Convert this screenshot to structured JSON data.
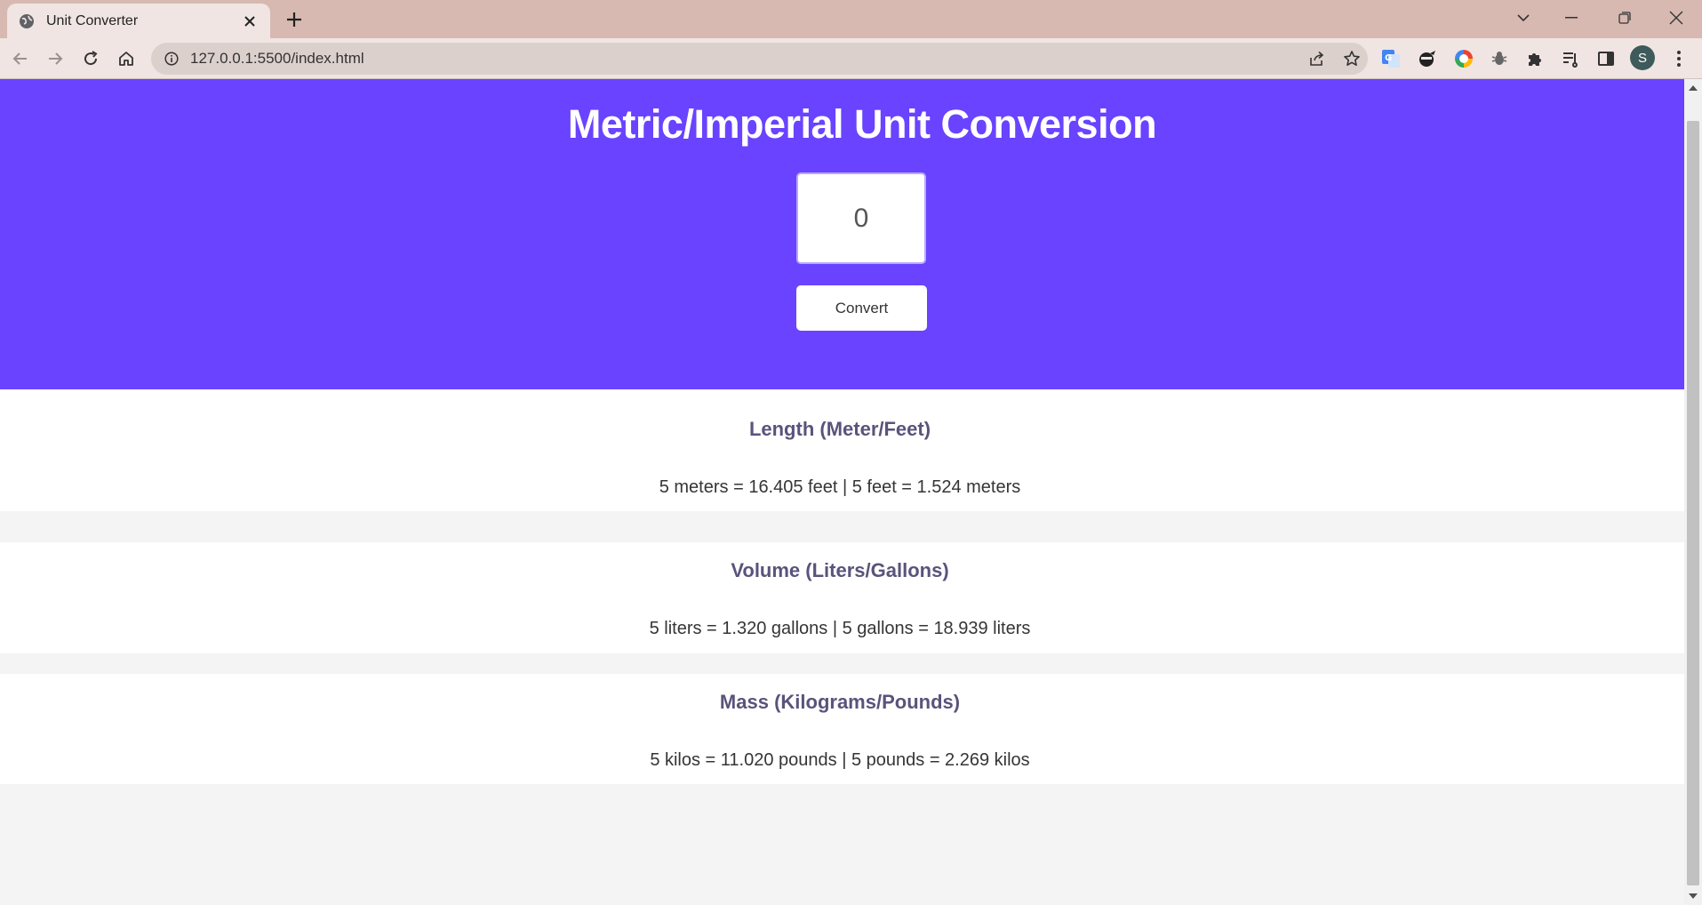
{
  "browser": {
    "tab_title": "Unit Converter",
    "url": "127.0.0.1:5500/index.html",
    "profile_initial": "S"
  },
  "page": {
    "title": "Metric/Imperial Unit Conversion",
    "input_value": "0",
    "convert_label": "Convert",
    "accent_color": "#6943ff"
  },
  "results": [
    {
      "heading": "Length (Meter/Feet)",
      "text": "5 meters = 16.405 feet | 5 feet = 1.524 meters"
    },
    {
      "heading": "Volume (Liters/Gallons)",
      "text": "5 liters = 1.320 gallons | 5 gallons = 18.939 liters"
    },
    {
      "heading": "Mass (Kilograms/Pounds)",
      "text": "5 kilos = 11.020 pounds | 5 pounds = 2.269 kilos"
    }
  ],
  "icons": {
    "tab_favicon": "globe-icon",
    "tab_close": "close-icon",
    "new_tab": "plus-icon",
    "back": "back-arrow-icon",
    "forward": "forward-arrow-icon",
    "reload": "reload-icon",
    "home": "home-icon",
    "site_info": "info-icon",
    "share": "share-icon",
    "bookmark": "star-icon",
    "translate": "translate-icon",
    "extensions": "puzzle-icon",
    "reading_list": "reading-list-icon",
    "side_panel": "side-panel-icon",
    "menu": "kebab-menu-icon"
  }
}
